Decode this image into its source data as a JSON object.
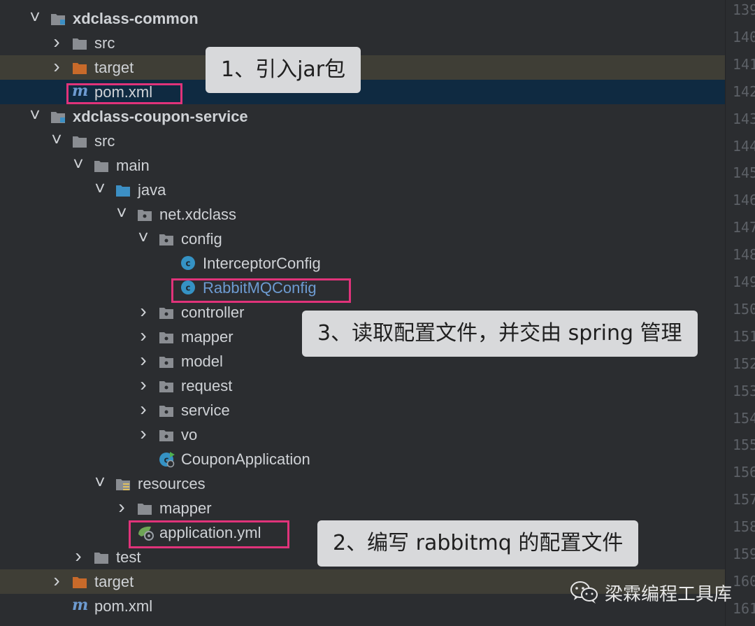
{
  "tree": {
    "rows": [
      {
        "label": "xdclass-common",
        "kind": "module",
        "bold": true,
        "chevron": "down",
        "indent": 0
      },
      {
        "label": "src",
        "kind": "folder",
        "chevron": "right",
        "indent": 1
      },
      {
        "label": "target",
        "kind": "folder-orange",
        "chevron": "right",
        "indent": 1,
        "style": "excluded"
      },
      {
        "label": "pom.xml",
        "kind": "maven",
        "chevron": "none",
        "indent": 1,
        "style": "selected"
      },
      {
        "label": "xdclass-coupon-service",
        "kind": "module",
        "bold": true,
        "chevron": "down",
        "indent": 0
      },
      {
        "label": "src",
        "kind": "folder",
        "chevron": "down",
        "indent": 1
      },
      {
        "label": "main",
        "kind": "folder",
        "chevron": "down",
        "indent": 2
      },
      {
        "label": "java",
        "kind": "folder-blue",
        "chevron": "down",
        "indent": 3
      },
      {
        "label": "net.xdclass",
        "kind": "package",
        "chevron": "down",
        "indent": 4
      },
      {
        "label": "config",
        "kind": "package",
        "chevron": "down",
        "indent": 5
      },
      {
        "label": "InterceptorConfig",
        "kind": "class",
        "chevron": "none",
        "indent": 6
      },
      {
        "label": "RabbitMQConfig",
        "kind": "class",
        "chevron": "none",
        "indent": 6,
        "blue": true
      },
      {
        "label": "controller",
        "kind": "package",
        "chevron": "right",
        "indent": 5
      },
      {
        "label": "mapper",
        "kind": "package",
        "chevron": "right",
        "indent": 5
      },
      {
        "label": "model",
        "kind": "package",
        "chevron": "right",
        "indent": 5
      },
      {
        "label": "request",
        "kind": "package",
        "chevron": "right",
        "indent": 5
      },
      {
        "label": "service",
        "kind": "package",
        "chevron": "right",
        "indent": 5
      },
      {
        "label": "vo",
        "kind": "package",
        "chevron": "right",
        "indent": 5
      },
      {
        "label": "CouponApplication",
        "kind": "spring-class",
        "chevron": "none",
        "indent": 5
      },
      {
        "label": "resources",
        "kind": "resources",
        "chevron": "down",
        "indent": 3
      },
      {
        "label": "mapper",
        "kind": "folder",
        "chevron": "right",
        "indent": 4
      },
      {
        "label": "application.yml",
        "kind": "yml",
        "chevron": "none",
        "indent": 4
      },
      {
        "label": "test",
        "kind": "folder",
        "chevron": "right",
        "indent": 2
      },
      {
        "label": "target",
        "kind": "folder-orange",
        "chevron": "right",
        "indent": 1,
        "style": "excluded"
      },
      {
        "label": "pom.xml",
        "kind": "maven",
        "chevron": "none",
        "indent": 1
      }
    ]
  },
  "gutter": {
    "lines": [
      "139",
      "140",
      "141",
      "142",
      "143",
      "144",
      "145",
      "146",
      "147",
      "148",
      "149",
      "150",
      "151",
      "152",
      "153",
      "154",
      "155",
      "156",
      "157",
      "158",
      "159",
      "160",
      "161"
    ]
  },
  "callouts": {
    "one": "1、引入jar包",
    "two": "2、编写 rabbitmq 的配置文件",
    "three": "3、读取配置文件，并交由 spring 管理"
  },
  "watermark": {
    "text": "梁霖编程工具库"
  },
  "colors": {
    "background": "#2b2d30",
    "selected_row": "#0f2a41",
    "excluded_row": "#3f3e36",
    "highlight_box": "#e0337a",
    "callout_bg": "#d8d9db",
    "folder": "#8a8d92",
    "folder_orange": "#c86a2a",
    "folder_blue": "#3c8fc4",
    "class_icon": "#3592c4"
  }
}
